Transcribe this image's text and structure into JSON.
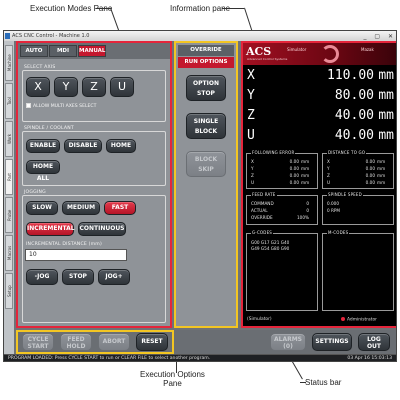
{
  "callouts": {
    "modes_pane": "Execution Modes Pane",
    "info_pane": "Information pane",
    "exec_options": "Execution Options",
    "exec_options_line2": "Pane",
    "status_bar": "Status bar"
  },
  "window": {
    "title": "ACS CNC Control - Machine 1.0",
    "buttons": "_ ▢ ✕"
  },
  "vtabs": [
    "Machine",
    "Tool",
    "Work",
    "Part",
    "Probe",
    "Macros",
    "Setup"
  ],
  "modes": {
    "tabs": [
      "AUTO",
      "MDI",
      "MANUAL"
    ],
    "select_axis_label": "SELECT AXIS",
    "axes": [
      "X",
      "Y",
      "Z",
      "U"
    ],
    "allow_multi": "ALLOW MULTI AXES SELECT",
    "spindle_label": "SPINDLE / COOLANT",
    "enable": "ENABLE",
    "disable": "DISABLE",
    "home": "HOME",
    "home_all": "HOME ALL",
    "jogging_label": "JOGGING",
    "slow": "SLOW",
    "medium": "MEDIUM",
    "fast": "FAST",
    "incremental": "INCREMENTAL",
    "continuous": "CONTINUOUS",
    "jog_distance_label": "INCREMENTAL DISTANCE (mm)",
    "jog_distance_value": "10",
    "jog_minus": "-JOG",
    "stop": "STOP",
    "jog_plus": "JOG+"
  },
  "exec": {
    "override": "OVERRIDE",
    "run_options": "RUN OPTIONS",
    "option_stop_1": "OPTION",
    "option_stop_2": "STOP",
    "single_block_1": "SINGLE",
    "single_block_2": "BLOCK",
    "block_skip_1": "BLOCK",
    "block_skip_2": "SKIP"
  },
  "info": {
    "logo": "ACS",
    "logo_sub": "Advanced Control Systems",
    "banner_left": "Simulator",
    "banner_right": "Mazak",
    "dro": [
      {
        "axis": "X",
        "value": "110.00",
        "unit": "mm"
      },
      {
        "axis": "Y",
        "value": "80.00",
        "unit": "mm"
      },
      {
        "axis": "Z",
        "value": "40.00",
        "unit": "mm"
      },
      {
        "axis": "U",
        "value": "40.00",
        "unit": "mm"
      }
    ],
    "following_title": "FOLLOWING ERROR",
    "following": [
      {
        "a": "X",
        "v": "0.00",
        "u": "mm"
      },
      {
        "a": "Y",
        "v": "0.00",
        "u": "mm"
      },
      {
        "a": "Z",
        "v": "0.00",
        "u": "mm"
      },
      {
        "a": "U",
        "v": "0.00",
        "u": "mm"
      }
    ],
    "dtg_title": "DISTANCE TO GO",
    "dtg": [
      {
        "a": "X",
        "v": "0.00",
        "u": "mm"
      },
      {
        "a": "Y",
        "v": "0.00",
        "u": "mm"
      },
      {
        "a": "Z",
        "v": "0.00",
        "u": "mm"
      },
      {
        "a": "U",
        "v": "0.00",
        "u": "mm"
      }
    ],
    "feed_title": "FEED RATE",
    "feed": [
      {
        "a": "COMMAND",
        "v": "0",
        "u": ""
      },
      {
        "a": "ACTUAL",
        "v": "0",
        "u": ""
      },
      {
        "a": "OVERRIDE",
        "v": "100%",
        "u": ""
      }
    ],
    "spindle_title": "SPINDLE SPEED",
    "spindle": [
      {
        "a": "",
        "v": "0.000",
        "u": ""
      },
      {
        "a": "",
        "v": "0 RPM",
        "u": ""
      }
    ],
    "gcodes_title": "G-CODES",
    "gcodes_text": "G00 G17 G21 G40\nG49 G54 G80 G90",
    "mcodes_title": "M-CODES",
    "footer_left": "(Simulator)",
    "footer_right": "Administrator"
  },
  "bottom": {
    "cycle_start_1": "CYCLE",
    "cycle_start_2": "START",
    "feed_hold_1": "FEED",
    "feed_hold_2": "HOLD",
    "abort": "ABORT",
    "reset": "RESET",
    "alarms_1": "ALARMS",
    "alarms_2": "(0)",
    "settings": "SETTINGS",
    "logout_1": "LOG",
    "logout_2": "OUT"
  },
  "status": {
    "message": "PROGRAM LOADED: Press CYCLE START to run or CLEAR FILE to select another program.",
    "time": "03 Apr 16 15:03:13"
  }
}
